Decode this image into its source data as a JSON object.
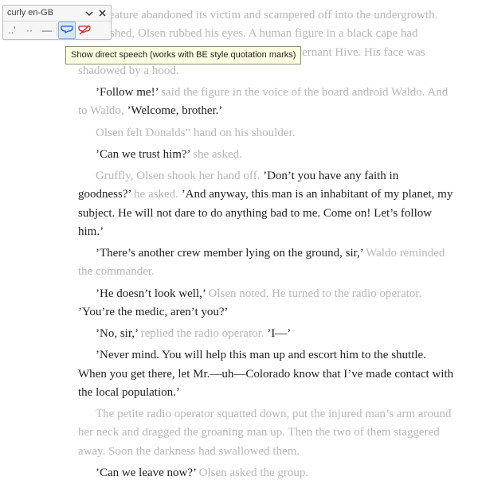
{
  "toolbar": {
    "title": "curly en-GB",
    "tooltip": "Show direct speech (works with BE style quotation marks)",
    "btn_dotquote": "..'",
    "btn_dotdot": "··",
    "btn_dash": "—"
  },
  "p": [
    [
      {
        "c": "n",
        "t": "The creature abandoned its victim and scampered off into the undergrowth. Astonished, Olsen rubbed his eyes. A human figure in a black cape had stepped between the crew members of the Governant Hive. His face was shadowed by a hood."
      }
    ],
    [
      {
        "c": "d",
        "t": "'Follow me!' "
      },
      {
        "c": "n",
        "t": "said the figure in the voice of the board android Waldo. And to Waldo, "
      },
      {
        "c": "d",
        "t": "'Welcome, brother.'"
      }
    ],
    [
      {
        "c": "n",
        "t": "Olsen felt Donalds'' hand on his shoulder."
      }
    ],
    [
      {
        "c": "d",
        "t": "'Can we trust him?' "
      },
      {
        "c": "n",
        "t": "she asked."
      }
    ],
    [
      {
        "c": "n",
        "t": "Gruffly, Olsen shook her hand off. "
      },
      {
        "c": "d",
        "t": "'Don't you have any faith in goodness?' "
      },
      {
        "c": "n",
        "t": "he asked. "
      },
      {
        "c": "d",
        "t": "'And anyway, this man is an inhabitant of my planet, my subject. He will not dare to do anything bad to me. Come on! Let's follow him.'"
      }
    ],
    [
      {
        "c": "d",
        "t": "'There's another crew member lying on the ground, sir,' "
      },
      {
        "c": "n",
        "t": "Waldo reminded the commander."
      }
    ],
    [
      {
        "c": "d",
        "t": "'He doesn't look well,' "
      },
      {
        "c": "n",
        "t": "Olsen noted. He turned to the radio operator. "
      },
      {
        "c": "d",
        "t": "'You're the medic, aren't you?'"
      }
    ],
    [
      {
        "c": "d",
        "t": "'No, sir,' "
      },
      {
        "c": "n",
        "t": "replied the radio operator. "
      },
      {
        "c": "d",
        "t": "'I—'"
      }
    ],
    [
      {
        "c": "d",
        "t": "'Never mind. You will help this man up and escort him to the shuttle. When you get there, let Mr.—uh—Colorado know that I've made contact with the local population.'"
      }
    ],
    [
      {
        "c": "n",
        "t": "The petite radio operator squatted down, put the injured man's arm around her neck and dragged the groaning man up. Then the two of them staggered away. Soon the darkness had swallowed them."
      }
    ],
    [
      {
        "c": "d",
        "t": "'Can we leave now?' "
      },
      {
        "c": "n",
        "t": "Olsen asked the group."
      }
    ]
  ],
  "p_class": [
    "no-indent",
    "",
    "",
    "",
    "",
    "",
    "",
    "",
    "",
    "",
    ""
  ]
}
